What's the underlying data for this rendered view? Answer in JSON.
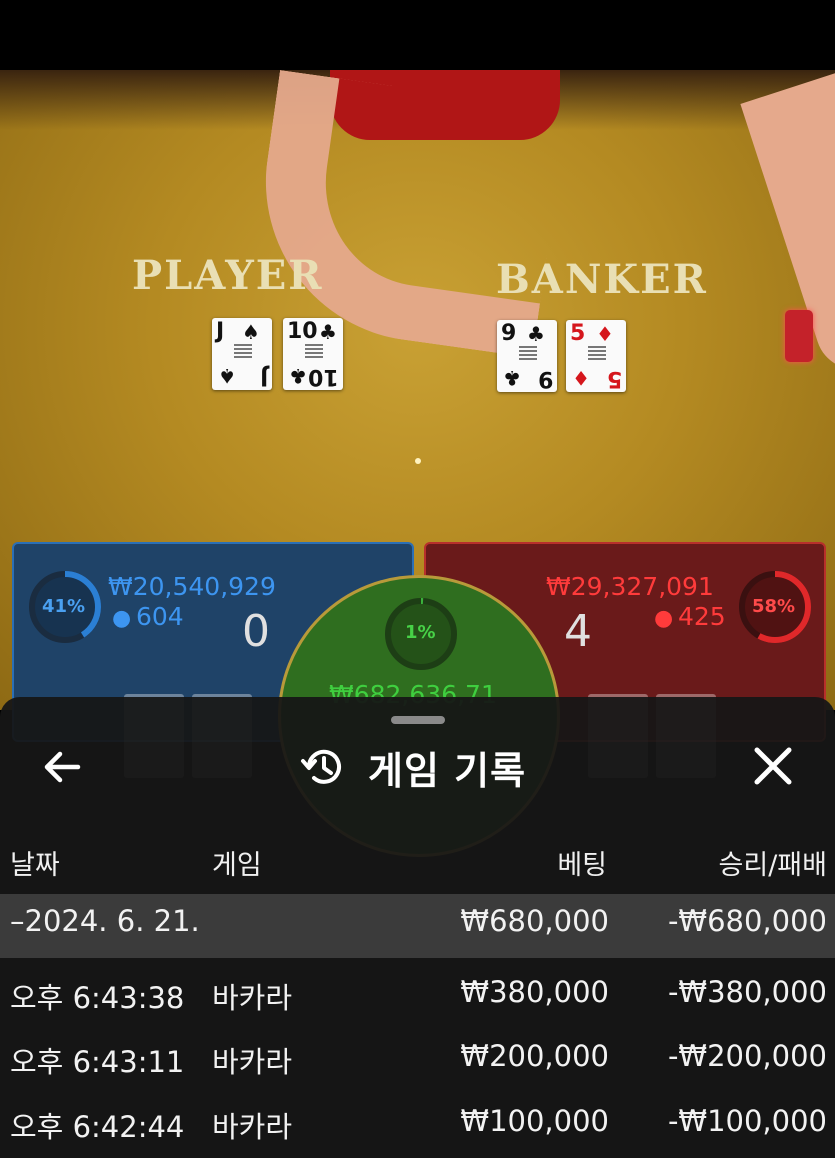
{
  "table": {
    "player_label": "PLAYER",
    "banker_label": "BANKER",
    "player_cards": [
      {
        "rank": "J",
        "suit": "♠",
        "color": "black"
      },
      {
        "rank": "10",
        "suit": "♣",
        "color": "black"
      }
    ],
    "banker_cards": [
      {
        "rank": "9",
        "suit": "♣",
        "color": "black"
      },
      {
        "rank": "5",
        "suit": "♦",
        "color": "red"
      }
    ]
  },
  "bets": {
    "player": {
      "percent": "41%",
      "percent_value": 41,
      "amount": "₩20,540,929",
      "players": "604",
      "score": "0",
      "color": "#2b7fd4"
    },
    "tie": {
      "percent": "1%",
      "percent_value": 1,
      "amount": "₩682,636,71",
      "color": "#3bb33b"
    },
    "banker": {
      "percent": "58%",
      "percent_value": 58,
      "amount": "₩29,327,091",
      "players": "425",
      "score": "4",
      "color": "#e0282a"
    }
  },
  "history": {
    "title": "게임 기록",
    "columns": {
      "date": "날짜",
      "game": "게임",
      "bet": "베팅",
      "result": "승리/패배"
    },
    "date_row": {
      "date": "2024. 6. 21.",
      "bet": "₩680,000",
      "result": "-₩680,000"
    },
    "rows": [
      {
        "time": "오후 6:43:38",
        "game": "바카라",
        "bet": "₩380,000",
        "result": "-₩380,000"
      },
      {
        "time": "오후 6:43:11",
        "game": "바카라",
        "bet": "₩200,000",
        "result": "-₩200,000"
      },
      {
        "time": "오후 6:42:44",
        "game": "바카라",
        "bet": "₩100,000",
        "result": "-₩100,000"
      }
    ]
  }
}
